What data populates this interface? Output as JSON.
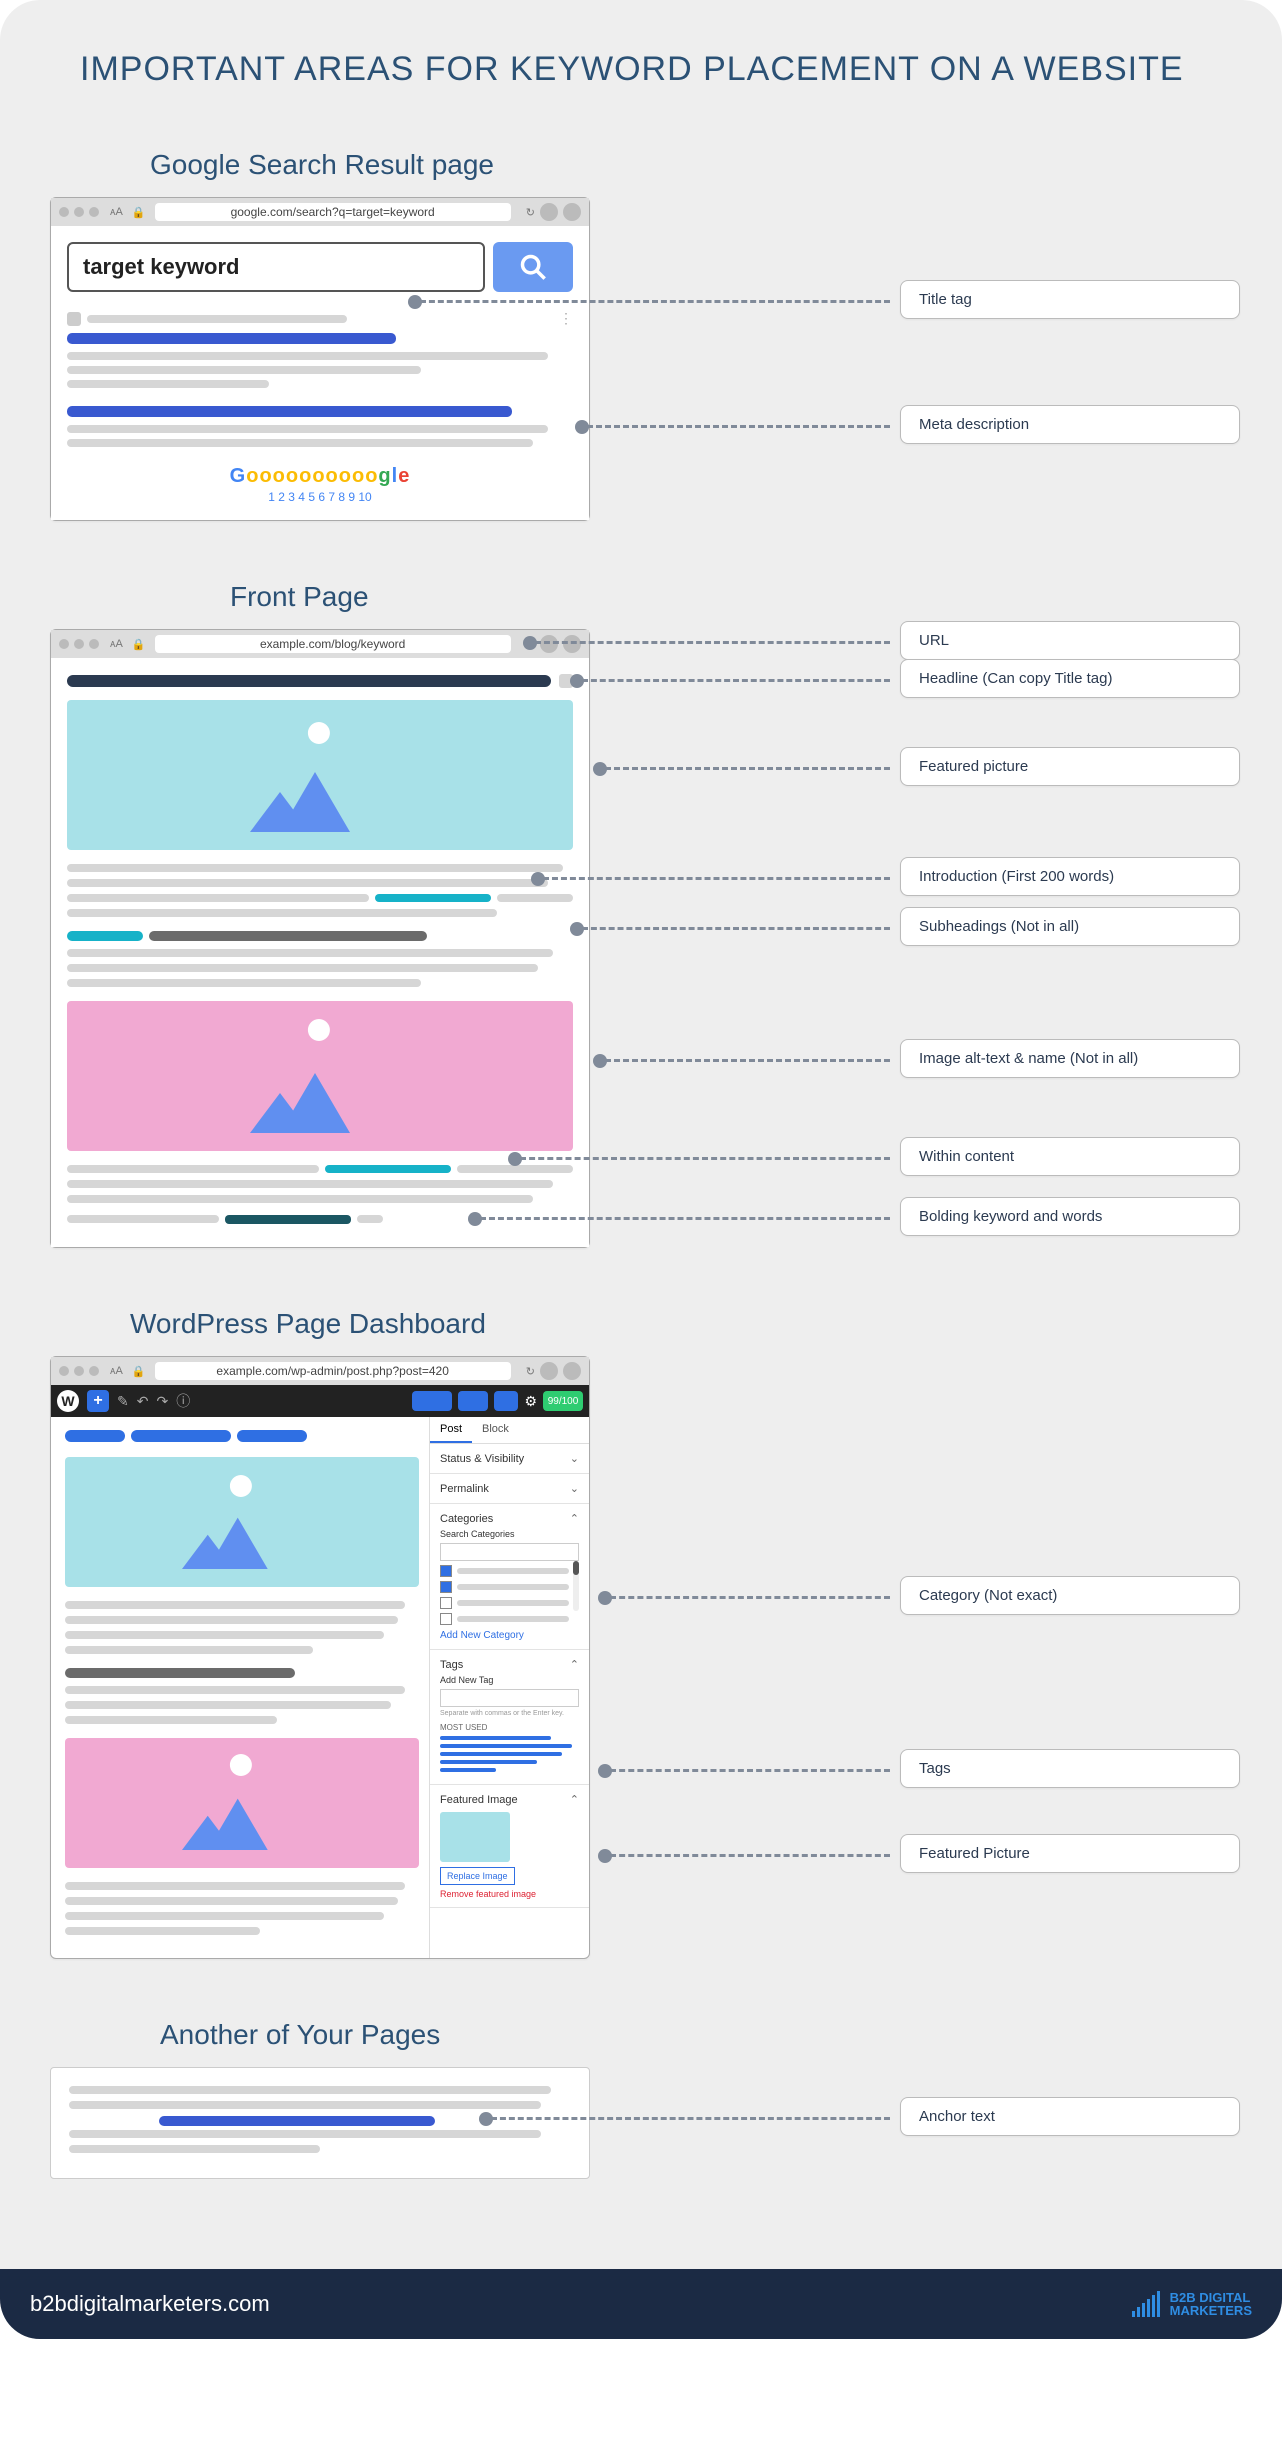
{
  "title": "IMPORTANT AREAS FOR KEYWORD PLACEMENT ON A WEBSITE",
  "sections": {
    "serp": "Google Search Result page",
    "front": "Front Page",
    "wp": "WordPress Page Dashboard",
    "another": "Another of Your Pages"
  },
  "serp": {
    "url": "google.com/search?q=target=keyword",
    "search_value": "target keyword",
    "pagination_logo": "Gooooooooooogle",
    "pagination": "1 2 3 4 5 6 7 8 9 10"
  },
  "front": {
    "url": "example.com/blog/keyword"
  },
  "wp": {
    "url": "example.com/wp-admin/post.php?post=420",
    "tabs": {
      "post": "Post",
      "block": "Block"
    },
    "status": "Status & Visibility",
    "permalink": "Permalink",
    "categories": "Categories",
    "search_categories": "Search Categories",
    "add_category": "Add New Category",
    "tags": "Tags",
    "add_tag": "Add New Tag",
    "tag_hint": "Separate with commas or the Enter key.",
    "most_used": "MOST USED",
    "featured_image": "Featured Image",
    "replace_image": "Replace Image",
    "remove_image": "Remove featured image",
    "score": "99/100"
  },
  "labels": {
    "title_tag": "Title tag",
    "meta_description": "Meta description",
    "url": "URL",
    "headline": "Headline (Can copy Title tag)",
    "featured_picture": "Featured picture",
    "introduction": "Introduction (First 200 words)",
    "subheadings": "Subheadings (Not in all)",
    "alt_text": "Image alt-text & name (Not in all)",
    "within_content": "Within content",
    "bolding": "Bolding keyword and words",
    "category": "Category (Not exact)",
    "tags": "Tags",
    "featured_picture2": "Featured Picture",
    "anchor": "Anchor text"
  },
  "footer": {
    "site": "b2bdigitalmarketers.com",
    "brand": "B2B DIGITAL\nMARKETERS"
  }
}
